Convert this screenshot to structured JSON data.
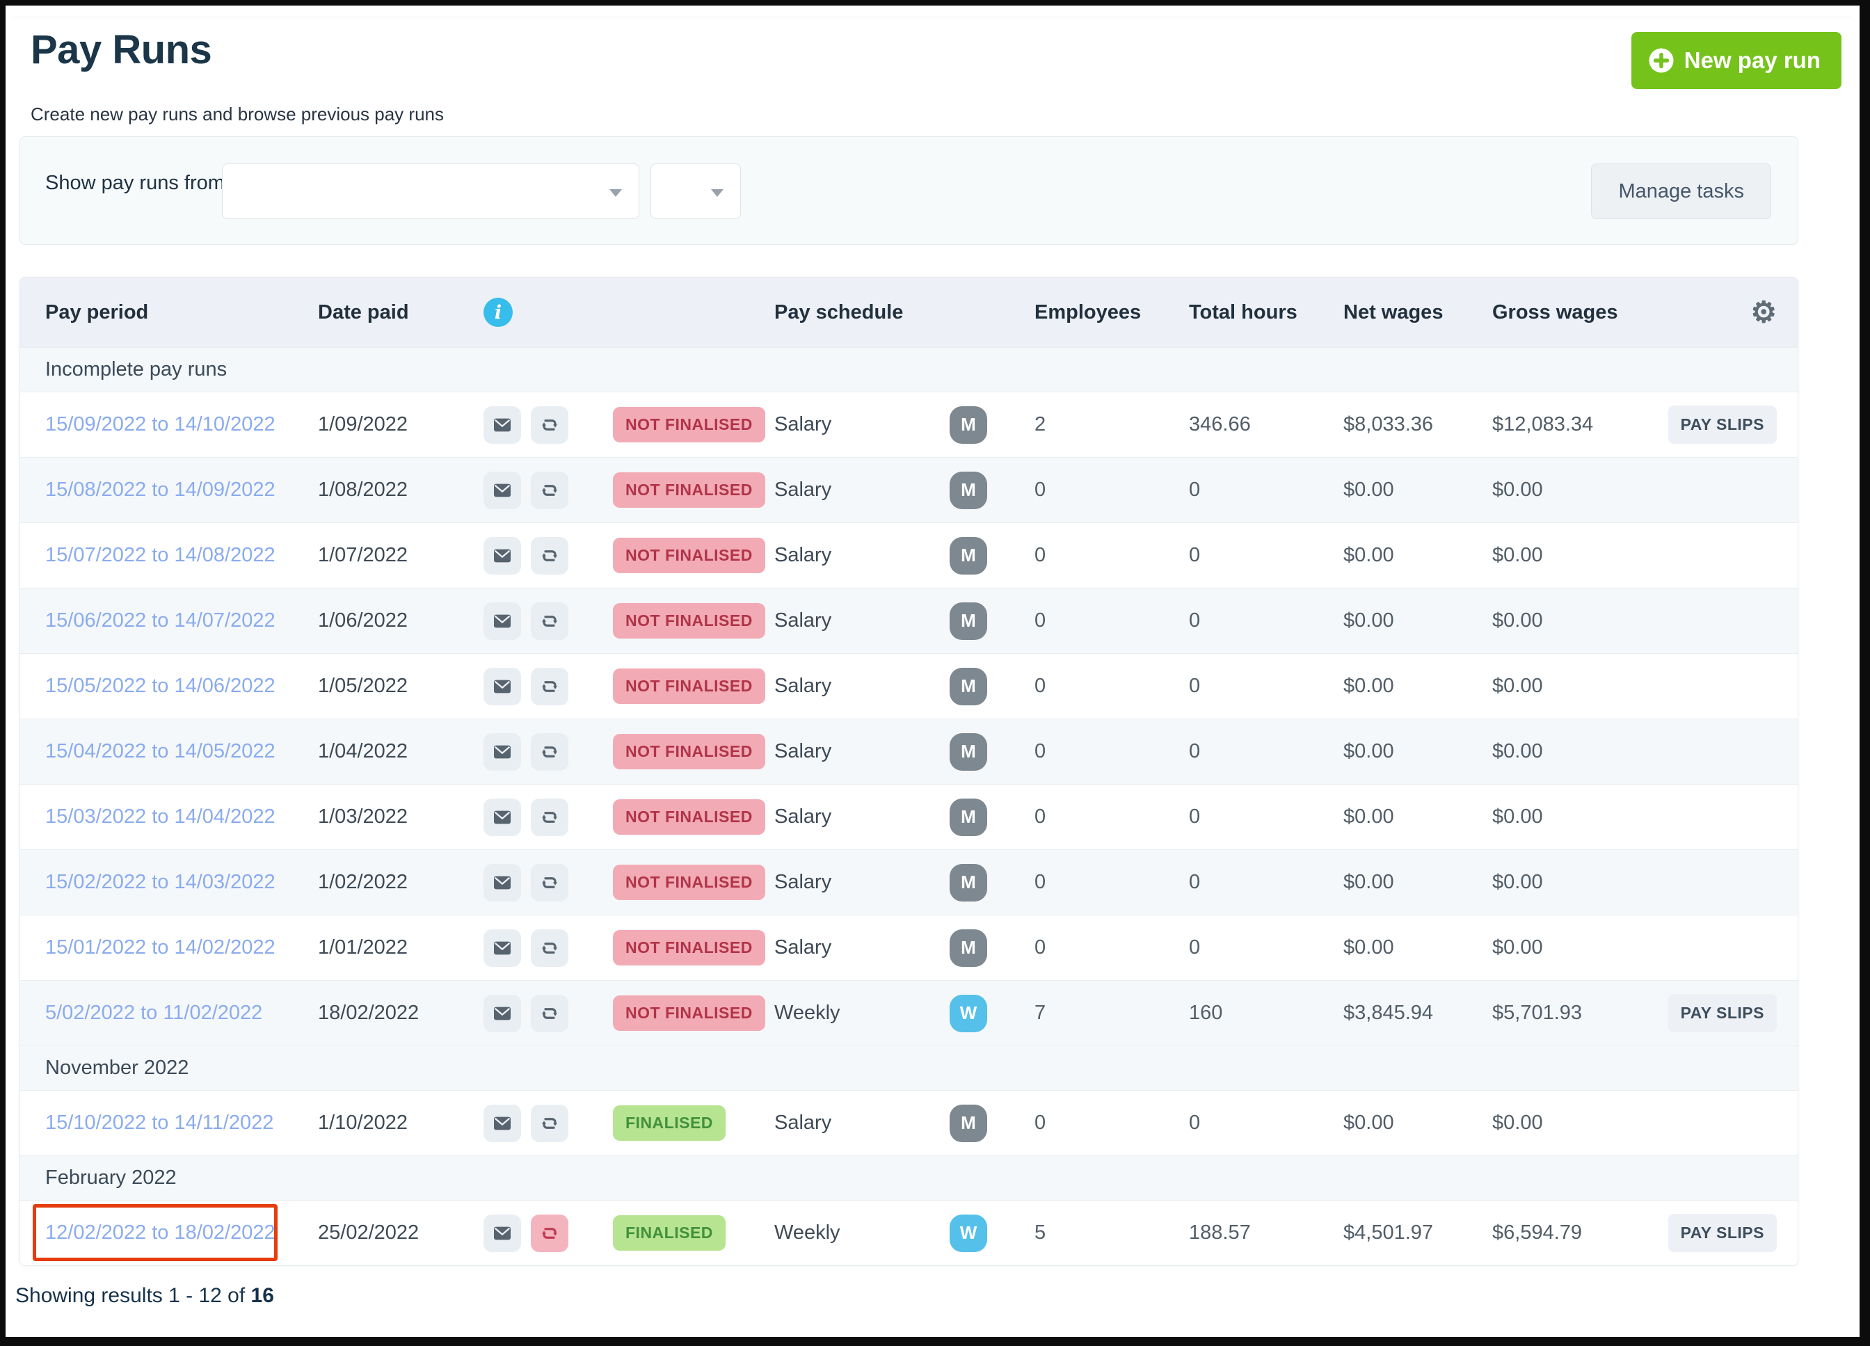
{
  "page": {
    "title": "Pay Runs",
    "subtitle": "Create new pay runs and browse previous pay runs",
    "actions": {
      "new_pay_run": "New pay run",
      "manage_tasks": "Manage tasks"
    },
    "filter": {
      "label": "Show pay runs from",
      "selects": [
        {
          "name": "pay-runs-from-select",
          "value": ""
        },
        {
          "name": "pay-runs-from-secondary-select",
          "value": ""
        }
      ]
    },
    "results_summary": {
      "prefix": "Showing results 1 - 12 of ",
      "total": "16"
    }
  },
  "icons": {
    "new_button": "plus-circle-icon",
    "info": "info-icon",
    "settings": "gear-icon",
    "email": "envelope-icon",
    "recurring": "refresh-icon",
    "dropdown": "chevron-down-icon"
  },
  "colors": {
    "accent_green": "#75c21b",
    "link_blue": "#8aabef",
    "not_finalised_bg": "#f2abb5",
    "not_finalised_text": "#b13349",
    "finalised_bg": "#b7e491",
    "finalised_text": "#41903c",
    "monthly_badge": "#7d8890",
    "weekly_badge": "#55c0e9",
    "header_row_bg": "#edf1f7",
    "alt_row_bg": "#f5f8fa",
    "highlight_red": "#e63c0c"
  },
  "table": {
    "headers": {
      "pay_period": "Pay period",
      "date_paid": "Date paid",
      "pay_schedule": "Pay schedule",
      "employees": "Employees",
      "total_hours": "Total hours",
      "net_wages": "Net wages",
      "gross_wages": "Gross wages"
    },
    "badges": {
      "pay_slips": "PAY SLIPS"
    },
    "groups": [
      {
        "label": "Incomplete pay runs",
        "rows": [
          {
            "period": "15/09/2022 to 14/10/2022",
            "date_paid": "1/09/2022",
            "status": "NOT FINALISED",
            "finalised": false,
            "schedule": "Salary",
            "schedule_code": "M",
            "employees": "2",
            "total_hours": "346.66",
            "net_wages": "$8,033.36",
            "gross_wages": "$12,083.34",
            "pay_slips": true,
            "recurring_alert": false,
            "highlighted": false
          },
          {
            "period": "15/08/2022 to 14/09/2022",
            "date_paid": "1/08/2022",
            "status": "NOT FINALISED",
            "finalised": false,
            "schedule": "Salary",
            "schedule_code": "M",
            "employees": "0",
            "total_hours": "0",
            "net_wages": "$0.00",
            "gross_wages": "$0.00",
            "pay_slips": false,
            "recurring_alert": false,
            "highlighted": false
          },
          {
            "period": "15/07/2022 to 14/08/2022",
            "date_paid": "1/07/2022",
            "status": "NOT FINALISED",
            "finalised": false,
            "schedule": "Salary",
            "schedule_code": "M",
            "employees": "0",
            "total_hours": "0",
            "net_wages": "$0.00",
            "gross_wages": "$0.00",
            "pay_slips": false,
            "recurring_alert": false,
            "highlighted": false
          },
          {
            "period": "15/06/2022 to 14/07/2022",
            "date_paid": "1/06/2022",
            "status": "NOT FINALISED",
            "finalised": false,
            "schedule": "Salary",
            "schedule_code": "M",
            "employees": "0",
            "total_hours": "0",
            "net_wages": "$0.00",
            "gross_wages": "$0.00",
            "pay_slips": false,
            "recurring_alert": false,
            "highlighted": false
          },
          {
            "period": "15/05/2022 to 14/06/2022",
            "date_paid": "1/05/2022",
            "status": "NOT FINALISED",
            "finalised": false,
            "schedule": "Salary",
            "schedule_code": "M",
            "employees": "0",
            "total_hours": "0",
            "net_wages": "$0.00",
            "gross_wages": "$0.00",
            "pay_slips": false,
            "recurring_alert": false,
            "highlighted": false
          },
          {
            "period": "15/04/2022 to 14/05/2022",
            "date_paid": "1/04/2022",
            "status": "NOT FINALISED",
            "finalised": false,
            "schedule": "Salary",
            "schedule_code": "M",
            "employees": "0",
            "total_hours": "0",
            "net_wages": "$0.00",
            "gross_wages": "$0.00",
            "pay_slips": false,
            "recurring_alert": false,
            "highlighted": false
          },
          {
            "period": "15/03/2022 to 14/04/2022",
            "date_paid": "1/03/2022",
            "status": "NOT FINALISED",
            "finalised": false,
            "schedule": "Salary",
            "schedule_code": "M",
            "employees": "0",
            "total_hours": "0",
            "net_wages": "$0.00",
            "gross_wages": "$0.00",
            "pay_slips": false,
            "recurring_alert": false,
            "highlighted": false
          },
          {
            "period": "15/02/2022 to 14/03/2022",
            "date_paid": "1/02/2022",
            "status": "NOT FINALISED",
            "finalised": false,
            "schedule": "Salary",
            "schedule_code": "M",
            "employees": "0",
            "total_hours": "0",
            "net_wages": "$0.00",
            "gross_wages": "$0.00",
            "pay_slips": false,
            "recurring_alert": false,
            "highlighted": false
          },
          {
            "period": "15/01/2022 to 14/02/2022",
            "date_paid": "1/01/2022",
            "status": "NOT FINALISED",
            "finalised": false,
            "schedule": "Salary",
            "schedule_code": "M",
            "employees": "0",
            "total_hours": "0",
            "net_wages": "$0.00",
            "gross_wages": "$0.00",
            "pay_slips": false,
            "recurring_alert": false,
            "highlighted": false
          },
          {
            "period": "5/02/2022 to 11/02/2022",
            "date_paid": "18/02/2022",
            "status": "NOT FINALISED",
            "finalised": false,
            "schedule": "Weekly",
            "schedule_code": "W",
            "employees": "7",
            "total_hours": "160",
            "net_wages": "$3,845.94",
            "gross_wages": "$5,701.93",
            "pay_slips": true,
            "recurring_alert": false,
            "highlighted": false
          }
        ]
      },
      {
        "label": "November 2022",
        "rows": [
          {
            "period": "15/10/2022 to 14/11/2022",
            "date_paid": "1/10/2022",
            "status": "FINALISED",
            "finalised": true,
            "schedule": "Salary",
            "schedule_code": "M",
            "employees": "0",
            "total_hours": "0",
            "net_wages": "$0.00",
            "gross_wages": "$0.00",
            "pay_slips": false,
            "recurring_alert": false,
            "highlighted": false
          }
        ]
      },
      {
        "label": "February 2022",
        "rows": [
          {
            "period": "12/02/2022 to 18/02/2022",
            "date_paid": "25/02/2022",
            "status": "FINALISED",
            "finalised": true,
            "schedule": "Weekly",
            "schedule_code": "W",
            "employees": "5",
            "total_hours": "188.57",
            "net_wages": "$4,501.97",
            "gross_wages": "$6,594.79",
            "pay_slips": true,
            "recurring_alert": true,
            "highlighted": true
          }
        ]
      }
    ]
  }
}
